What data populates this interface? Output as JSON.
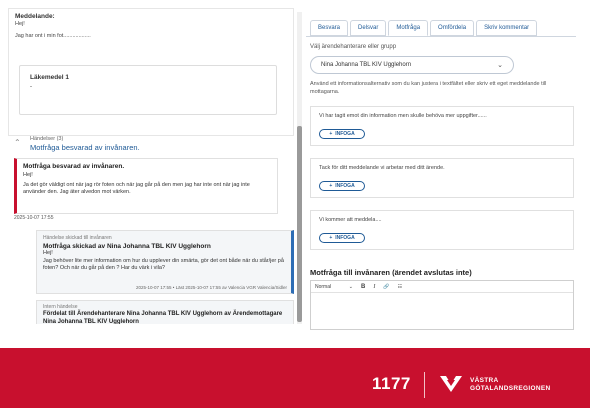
{
  "message_card": {
    "label": "Meddelande:",
    "greeting": "Hej!",
    "body": "Jag har ont i min fot..................",
    "medicine_title": "Läkemedel 1",
    "medicine_value": "-"
  },
  "handelser": {
    "count_label": "Händelser (3)",
    "title": "Motfråga besvarad av invånaren.",
    "event1": {
      "title": "Motfråga besvarad av invånaren.",
      "greeting": "Hej!",
      "text": "Ja det gör väldigt ont när jag rör foten och när jag går på den men jag har inte ont när jag inte använder den. Jag äter alvedon mot värken.",
      "timestamp": "2025-10-07 17:55"
    },
    "event2": {
      "small": "Händelse skickad till invånaren",
      "title": "Motfråga skickad av Nina Johanna TBL KIV Ugglehorn",
      "greeting": "Hej!",
      "text": "Jag behöver lite mer information om hur du upplever din smärta, gör det ont både när du står/jer på foten? Och när du går på den ? Har du värk i vila?",
      "footer": "2025-10-07 17:55 • Läst 2025-10-07 17:55 av Valencia VGR Valencia/Sidler"
    },
    "event3": {
      "small": "Intern händelse",
      "title": "Fördelat till Ärendehanterare Nina Johanna TBL KIV Ugglehorn av Ärendemottagare Nina Johanna TBL KIV Ugglehorn"
    }
  },
  "tabs": [
    "Besvara",
    "Delsvar",
    "Motfråga",
    "Omfördela",
    "Skriv kommentar"
  ],
  "active_tab": "Motfråga",
  "group_select": {
    "label": "Välj ärendehanterare eller grupp",
    "value": "Nina Johanna TBL KIV Ugglehorn"
  },
  "hint": "Använd ett informationsalternativ som du kan justera i textfältet eller skriv ett eget meddelande till mottagarna.",
  "templates": [
    {
      "text": "Vi har tagit emot din information men skulle behöva mer uppgifter......",
      "button": "INFOGA"
    },
    {
      "text": "Tack för ditt meddelande vi arbetar med ditt ärende.",
      "button": "INFOGA"
    },
    {
      "text": "Vi kommer att meddela....",
      "button": "INFOGA"
    }
  ],
  "reply": {
    "title": "Motfråga till invånaren (ärendet avslutas inte)",
    "format": "Normal",
    "bold": "B",
    "italic": "I",
    "link": "🔗",
    "list": "☷"
  },
  "footer": {
    "brand": "1177",
    "region_line1": "VÄSTRA",
    "region_line2": "GÖTALANDSREGIONEN",
    "color": "#c8102e"
  }
}
